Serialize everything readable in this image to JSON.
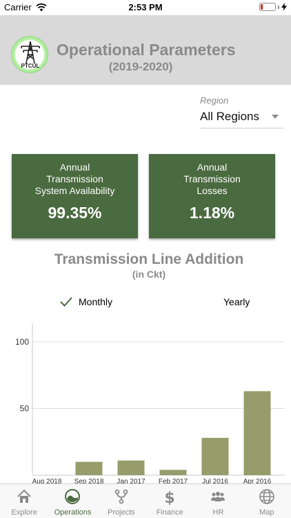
{
  "status_bar": {
    "carrier": "Carrier",
    "time": "2:53 PM",
    "battery_color": "#e0251b",
    "battery_level": 0.15
  },
  "header": {
    "logo_text": "PTCUL",
    "title": "Operational Parameters",
    "subtitle": "(2019-2020)",
    "background": "#d9d9d9"
  },
  "region": {
    "label": "Region",
    "value": "All Regions"
  },
  "cards": [
    {
      "title": "Annual\nTransmission\nSystem Availability",
      "value": "99.35%"
    },
    {
      "title": "Annual\nTransmission\nLosses",
      "value": "1.18%"
    }
  ],
  "card_color": "#4a6a3f",
  "chart_heading": {
    "title": "Transmission Line Addition",
    "subtitle": "(in Ckt)"
  },
  "toggle": {
    "monthly_label": "Monthly",
    "yearly_label": "Yearly",
    "selected": "monthly"
  },
  "chart_data": {
    "type": "bar",
    "categories": [
      "Aug 2018",
      "Sep 2018",
      "Jan 2017",
      "Feb 2017",
      "Jul 2016",
      "Apr 2016"
    ],
    "values": [
      0,
      10,
      11,
      4,
      28,
      63
    ],
    "ylim": [
      0,
      100
    ],
    "yticks": [
      50,
      100
    ],
    "grid": true,
    "bar_color": "#979d6a"
  },
  "tabs": [
    {
      "label": "Explore",
      "icon": "home-icon",
      "active": false
    },
    {
      "label": "Operations",
      "icon": "gauge-icon",
      "active": true
    },
    {
      "label": "Projects",
      "icon": "fork-icon",
      "active": false
    },
    {
      "label": "Finance",
      "icon": "dollar-icon",
      "active": false
    },
    {
      "label": "HR",
      "icon": "people-icon",
      "active": false
    },
    {
      "label": "Map",
      "icon": "globe-icon",
      "active": false
    }
  ],
  "active_color": "#4a6a3f"
}
